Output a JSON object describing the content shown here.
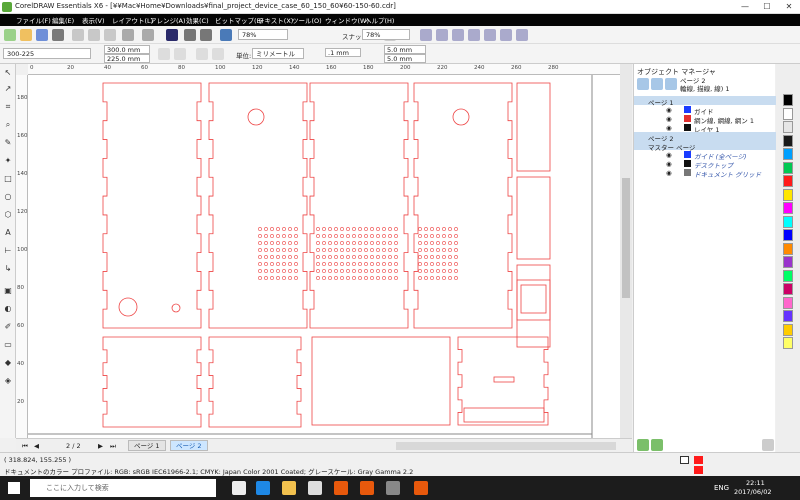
{
  "window": {
    "title": "CorelDRAW Essentials X6 - [¥¥Mac¥Home¥Downloads¥final_project_device_case_60_150_60¥60-150-60.cdr]",
    "minimize": "—",
    "maximize": "☐",
    "close": "✕"
  },
  "menu": [
    "ファイル(F)",
    "編集(E)",
    "表示(V)",
    "レイアウト(L)",
    "アレンジ(A)",
    "効果(C)",
    "ビットマップ(B)",
    "テキスト(X)",
    "ツール(O)",
    "ウィンドウ(W)",
    "ヘルプ(H)"
  ],
  "toolbar1": {
    "zoom_value": "78%",
    "snap_label": "スナップ(P)",
    "zoom_value2": "78%"
  },
  "toolbar2": {
    "preset": "300-225",
    "width": "300.0 mm",
    "height": "225.0 mm",
    "units_label": "単位:",
    "units_value": "ミリメートル",
    "nudge": ".1 mm",
    "dup_x": "5.0 mm",
    "dup_y": "5.0 mm"
  },
  "ruler": {
    "h_ticks": [
      "0",
      "20",
      "40",
      "60",
      "80",
      "100",
      "120",
      "140",
      "160",
      "180",
      "200",
      "220",
      "240",
      "260",
      "280"
    ],
    "v_ticks": [
      "180",
      "160",
      "140",
      "120",
      "100",
      "80",
      "60",
      "40",
      "20"
    ],
    "unit": "ミリメートル"
  },
  "page_nav": {
    "counter": "2 / 2",
    "tabs": [
      "ページ 1",
      "ページ 2"
    ],
    "active": 1
  },
  "docker": {
    "title": "オブジェクト マネージャ",
    "header_line1": "ページ 2",
    "header_line2": "輪線, 描線, 線) 1",
    "rows": [
      {
        "label": "ページ 1",
        "type": "page",
        "color": ""
      },
      {
        "label": "ガイド",
        "type": "layer",
        "color": "#1a3cff"
      },
      {
        "label": "網ン線, 網線, 網ン 1",
        "type": "layer",
        "color": "#e23030"
      },
      {
        "label": "レイヤ 1",
        "type": "layer",
        "color": "#111111"
      },
      {
        "label": "ページ 2",
        "type": "page",
        "color": ""
      },
      {
        "label": "マスター ページ",
        "type": "page",
        "color": ""
      },
      {
        "label": "ガイド (全ページ)",
        "type": "master",
        "color": "#1a3cff"
      },
      {
        "label": "デスクトップ",
        "type": "master",
        "color": "#111111"
      },
      {
        "label": "ドキュメント グリッド",
        "type": "master",
        "color": "#777777"
      }
    ]
  },
  "palette": [
    "#000000",
    "#ffffff",
    "#e6e6e6",
    "#1a1a1a",
    "#00a0ff",
    "#00c853",
    "#ff1a1a",
    "#ffe600",
    "#ff00ff",
    "#00ffff",
    "#0000ff",
    "#ff8a00",
    "#9933cc",
    "#00ff66",
    "#cc0066",
    "#ff66cc",
    "#6633ff",
    "#ffcc00",
    "#ffff66"
  ],
  "status": {
    "coords": "( 318.824, 155.255 )",
    "profile": "ドキュメントのカラー プロファイル: RGB: sRGB IEC61966-2.1; CMYK: Japan Color 2001 Coated; グレースケール: Gray Gamma 2.2"
  },
  "taskbar": {
    "search_placeholder": "ここに入力して検索",
    "lang": "ENG",
    "time": "22:11",
    "date": "2017/06/02"
  },
  "colors": {
    "cut_line": "#ee4444",
    "selection_blue": "#c8dcf0",
    "menubar": "#050505"
  }
}
